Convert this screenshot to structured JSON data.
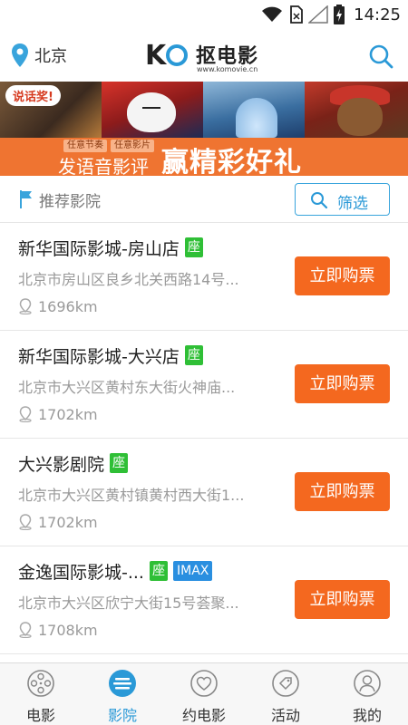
{
  "status_bar": {
    "time": "14:25"
  },
  "header": {
    "city": "北京",
    "logo_mark": "K",
    "logo_name": "抠电影",
    "logo_url": "www.komovie.cn"
  },
  "banner": {
    "bubble": "说话奖!",
    "tags": [
      "任意节奏",
      "任意影片"
    ],
    "main_text": "发语音影评",
    "big_text": "赢精彩好礼"
  },
  "recommend": {
    "label": "推荐影院",
    "filter_label": "筛选"
  },
  "cinemas": [
    {
      "name": "新华国际影城-房山店",
      "seat": "座",
      "imax": "",
      "address": "北京市房山区良乡北关西路14号...",
      "distance": "1696km",
      "buy": "立即购票"
    },
    {
      "name": "新华国际影城-大兴店",
      "seat": "座",
      "imax": "",
      "address": "北京市大兴区黄村东大街火神庙...",
      "distance": "1702km",
      "buy": "立即购票"
    },
    {
      "name": "大兴影剧院",
      "seat": "座",
      "imax": "",
      "address": "北京市大兴区黄村镇黄村西大街1...",
      "distance": "1702km",
      "buy": "立即购票"
    },
    {
      "name": "金逸国际影城-...",
      "seat": "座",
      "imax": "IMAX",
      "address": "北京市大兴区欣宁大街15号荟聚...",
      "distance": "1708km",
      "buy": "立即购票"
    }
  ],
  "bottom_nav": [
    {
      "label": "电影",
      "icon": "film-reel-icon",
      "active": false
    },
    {
      "label": "影院",
      "icon": "cinema-icon",
      "active": true
    },
    {
      "label": "约电影",
      "icon": "heart-icon",
      "active": false
    },
    {
      "label": "活动",
      "icon": "tag-icon",
      "active": false
    },
    {
      "label": "我的",
      "icon": "user-icon",
      "active": false
    }
  ],
  "colors": {
    "accent": "#2a99d7",
    "buy": "#f4681f",
    "seat_badge": "#2fbf36",
    "imax_badge": "#2a8fe0"
  }
}
